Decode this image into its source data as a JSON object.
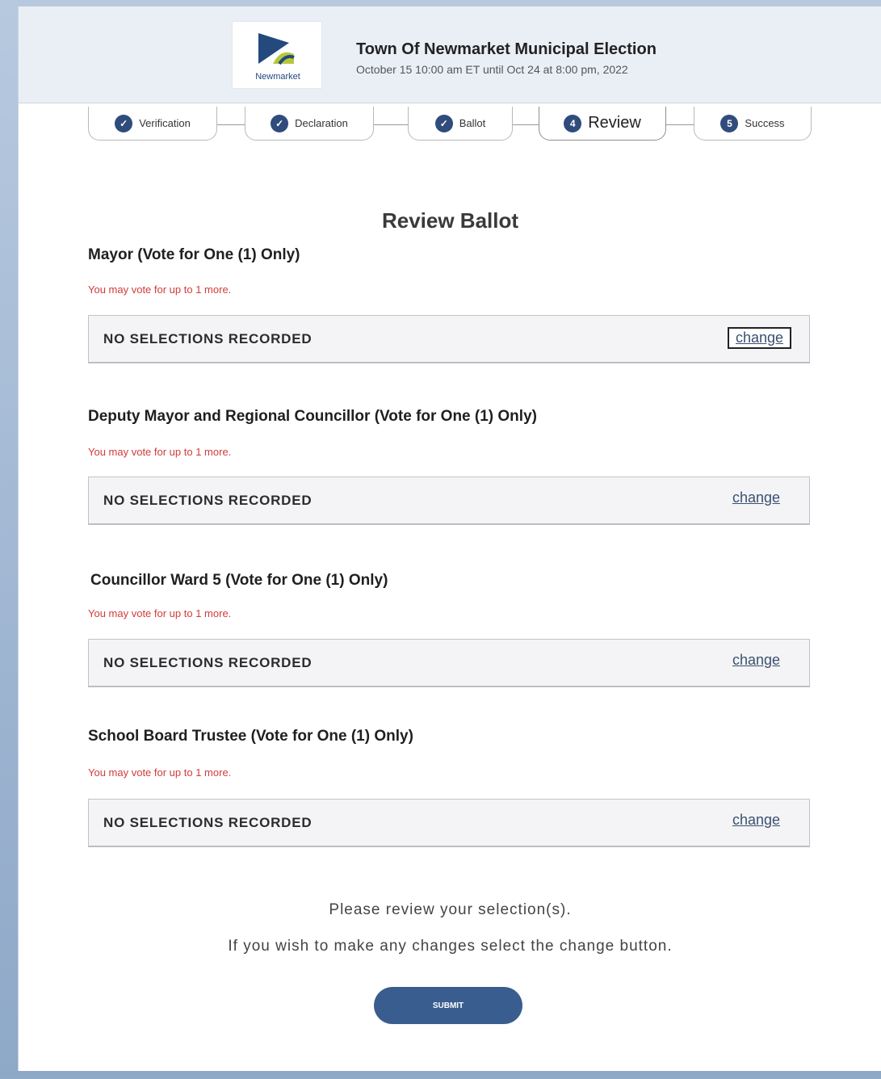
{
  "header": {
    "logo_text": "Newmarket",
    "title": "Town Of Newmarket Municipal Election",
    "dates": "October 15 10:00 am ET until Oct 24 at 8:00 pm, 2022"
  },
  "steps": [
    {
      "label": "Verification",
      "badge": "✓",
      "state": "done"
    },
    {
      "label": "Declaration",
      "badge": "✓",
      "state": "done"
    },
    {
      "label": "Ballot",
      "badge": "✓",
      "state": "done"
    },
    {
      "label": "Review",
      "badge": "4",
      "state": "active"
    },
    {
      "label": "Success",
      "badge": "5",
      "state": "pending"
    }
  ],
  "page_title": "Review Ballot",
  "races": [
    {
      "title": "Mayor (Vote for One (1) Only)",
      "note": "You may vote for up to 1 more.",
      "selection": "NO SELECTIONS RECORDED",
      "change_label": "change"
    },
    {
      "title": "Deputy Mayor and Regional Councillor (Vote for One (1) Only)",
      "note": "You may vote for up to 1 more.",
      "selection": "NO SELECTIONS RECORDED",
      "change_label": "change"
    },
    {
      "title": "Councillor Ward 5 (Vote for One (1) Only)",
      "note": "You may vote for up to 1 more.",
      "selection": "NO SELECTIONS RECORDED",
      "change_label": "change"
    },
    {
      "title": "School Board Trustee (Vote for One (1) Only)",
      "note": "You may vote for up to 1 more.",
      "selection": "NO SELECTIONS RECORDED",
      "change_label": "change"
    }
  ],
  "footer": {
    "review_msg_1": "Please review your selection(s).",
    "review_msg_2": "If you wish to make any changes select the change button.",
    "submit_label": "SUBMIT"
  },
  "colors": {
    "brand": "#2f4c7c",
    "warning_text": "#d23b3b",
    "submit": "#3a5d8f"
  }
}
